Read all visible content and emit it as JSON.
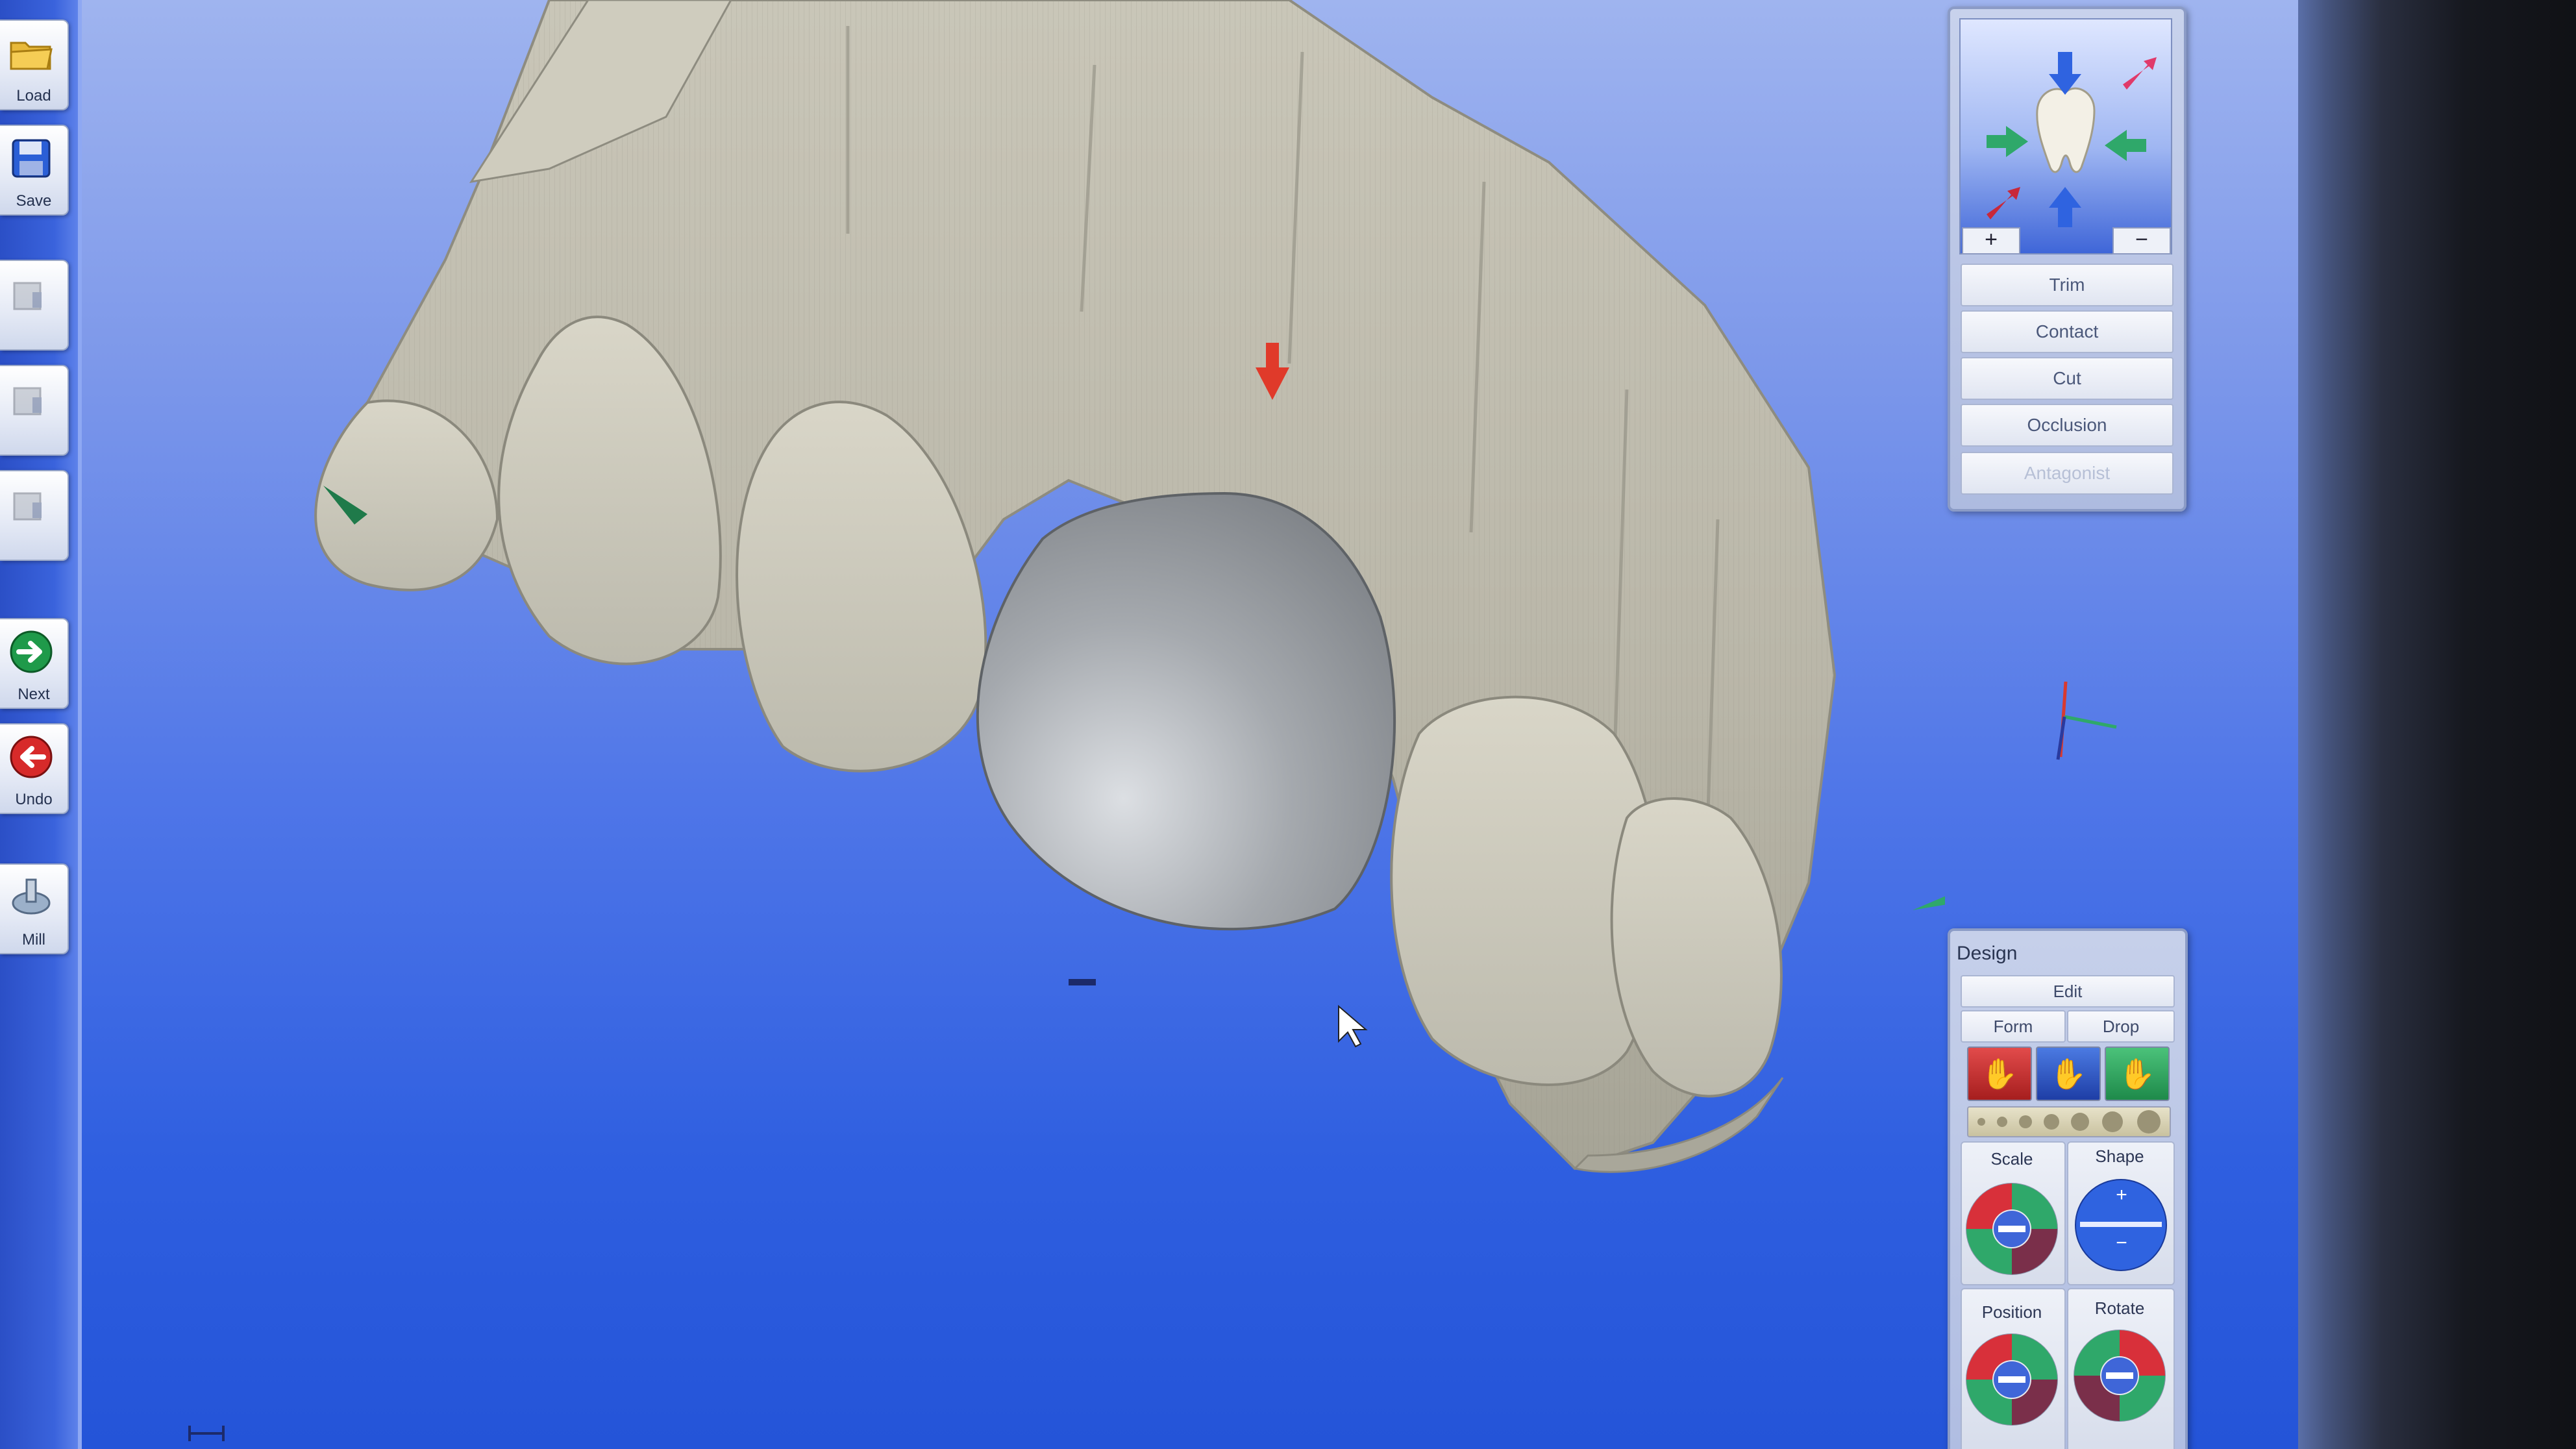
{
  "toolbar": {
    "items": [
      {
        "label": "Load",
        "icon": "folder-icon",
        "enabled": true
      },
      {
        "label": "Save",
        "icon": "floppy-disk-icon",
        "enabled": true
      },
      {
        "label": "",
        "icon": "model-icon",
        "enabled": false
      },
      {
        "label": "",
        "icon": "model-icon",
        "enabled": false
      },
      {
        "label": "",
        "icon": "model-icon",
        "enabled": false
      },
      {
        "label": "Next",
        "icon": "next-arrow-icon",
        "enabled": true
      },
      {
        "label": "Undo",
        "icon": "undo-arrow-icon",
        "enabled": true
      },
      {
        "label": "Mill",
        "icon": "mill-icon",
        "enabled": true
      }
    ]
  },
  "nav_panel": {
    "zoom_in": "+",
    "zoom_out": "−",
    "buttons": [
      {
        "label": "Trim",
        "enabled": true
      },
      {
        "label": "Contact",
        "enabled": true
      },
      {
        "label": "Cut",
        "enabled": true
      },
      {
        "label": "Occlusion",
        "enabled": true
      },
      {
        "label": "Antagonist",
        "enabled": false
      }
    ]
  },
  "design_panel": {
    "title": "Design",
    "edit_label": "Edit",
    "form_label": "Form",
    "drop_label": "Drop",
    "scale_label": "Scale",
    "shape_label": "Shape",
    "shape_plus": "+",
    "shape_minus": "−",
    "position_label": "Position",
    "rotate_label": "Rotate"
  },
  "colors": {
    "accent_red": "#e03a2a",
    "accent_green": "#2fa86a",
    "accent_blue": "#2f63e0"
  }
}
